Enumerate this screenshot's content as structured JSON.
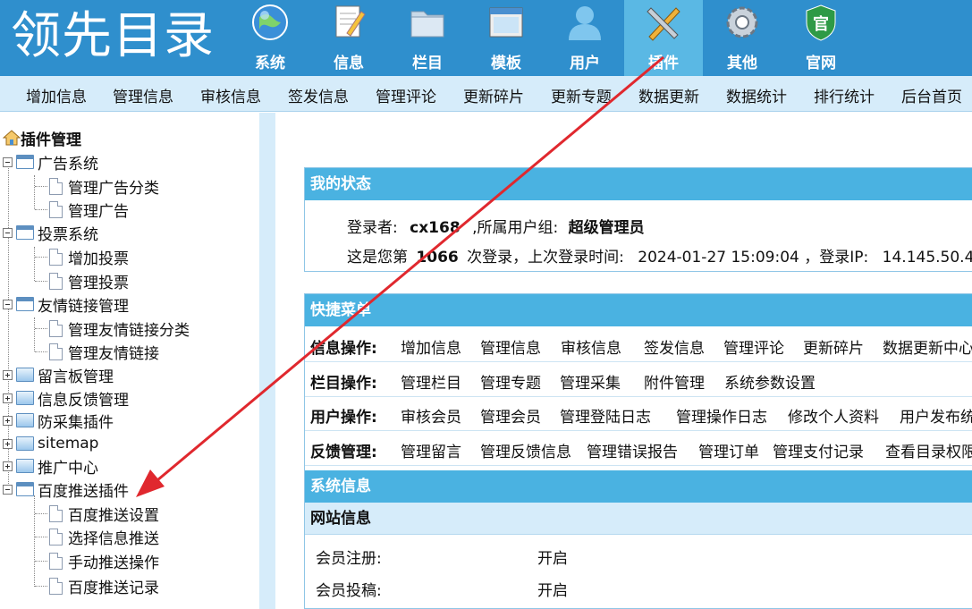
{
  "app": {
    "logo_text": "领先目录"
  },
  "top_nav": [
    {
      "label": "系统",
      "icon": "globe-icon"
    },
    {
      "label": "信息",
      "icon": "document-pencil-icon"
    },
    {
      "label": "栏目",
      "icon": "folder-icon"
    },
    {
      "label": "模板",
      "icon": "window-icon"
    },
    {
      "label": "用户",
      "icon": "user-icon"
    },
    {
      "label": "插件",
      "icon": "tools-icon",
      "active": true
    },
    {
      "label": "其他",
      "icon": "gear-icon"
    },
    {
      "label": "官网",
      "icon": "shield-badge-icon",
      "badge": "官"
    }
  ],
  "sub_nav": [
    "增加信息",
    "管理信息",
    "审核信息",
    "签发信息",
    "管理评论",
    "更新碎片",
    "更新专题",
    "数据更新",
    "数据统计",
    "排行统计",
    "后台首页"
  ],
  "tree": {
    "root": "插件管理",
    "groups": [
      {
        "label": "广告系统",
        "expanded": true,
        "children": [
          "管理广告分类",
          "管理广告"
        ]
      },
      {
        "label": "投票系统",
        "expanded": true,
        "children": [
          "增加投票",
          "管理投票"
        ]
      },
      {
        "label": "友情链接管理",
        "expanded": true,
        "children": [
          "管理友情链接分类",
          "管理友情链接"
        ]
      },
      {
        "label": "留言板管理",
        "expanded": false,
        "children": []
      },
      {
        "label": "信息反馈管理",
        "expanded": false,
        "children": []
      },
      {
        "label": "防采集插件",
        "expanded": false,
        "children": []
      },
      {
        "label": "sitemap",
        "expanded": false,
        "children": []
      },
      {
        "label": "推广中心",
        "expanded": false,
        "children": []
      },
      {
        "label": "百度推送插件",
        "expanded": true,
        "children": [
          "百度推送设置",
          "选择信息推送",
          "手动推送操作",
          "百度推送记录"
        ]
      }
    ]
  },
  "status": {
    "title": "我的状态",
    "login_label": "登录者:",
    "username": "cx168",
    "group_label": ",所属用户组:",
    "group": "超级管理员",
    "count_prefix": "这是您第",
    "count": "1066",
    "count_suffix": "次登录，上次登录时间:",
    "last_time": "2024-01-27 15:09:04",
    "ip_label": "，登录IP:",
    "ip": "14.145.50.4"
  },
  "quick": {
    "title": "快捷菜单",
    "rows": [
      {
        "label": "信息操作:",
        "links": [
          "增加信息",
          "管理信息",
          "审核信息",
          "签发信息",
          "管理评论",
          "更新碎片",
          "数据更新中心"
        ]
      },
      {
        "label": "栏目操作:",
        "links": [
          "管理栏目",
          "管理专题",
          "管理采集",
          "附件管理",
          "系统参数设置"
        ]
      },
      {
        "label": "用户操作:",
        "links": [
          "审核会员",
          "管理会员",
          "管理登陆日志",
          "管理操作日志",
          "修改个人资料",
          "用户发布统"
        ]
      },
      {
        "label": "反馈管理:",
        "links": [
          "管理留言",
          "管理反馈信息",
          "管理错误报告",
          "管理订单",
          "管理支付记录",
          "查看目录权限"
        ]
      }
    ]
  },
  "sysinfo": {
    "title": "系统信息",
    "subtitle": "网站信息",
    "rows": [
      {
        "label": "会员注册:",
        "value": "开启"
      },
      {
        "label": "会员投稿:",
        "value": "开启"
      }
    ]
  },
  "colors": {
    "header": "#2f8fcd",
    "active_tab": "#5ab8e4",
    "arrow": "#e0282e",
    "panel_title": "#4ab2e1"
  }
}
